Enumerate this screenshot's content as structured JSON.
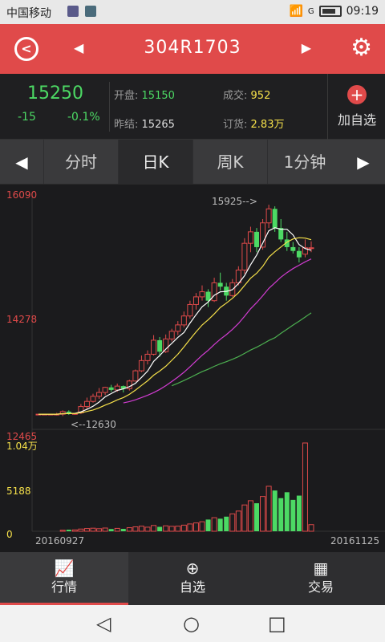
{
  "status": {
    "carrier": "中国移动",
    "signal_label": "G",
    "time": "09:19"
  },
  "header": {
    "title": "304R1703",
    "back_icon": "back-circle-icon",
    "settings_icon": "gear-icon"
  },
  "quote": {
    "price": "15250",
    "change": "-15",
    "change_pct": "-0.1%",
    "open_label": "开盘:",
    "open_value": "15150",
    "prev_label": "昨结:",
    "prev_value": "15265",
    "vol_label": "成交:",
    "vol_value": "952",
    "oi_label": "订货:",
    "oi_value": "2.83万",
    "add_label": "加自选"
  },
  "tabs": {
    "items": [
      "分时",
      "日K",
      "周K",
      "1分钟"
    ],
    "active": 1
  },
  "chart_data": {
    "type": "candlestick",
    "price_axis": {
      "max": "16090",
      "mid": "14278",
      "min": "12465"
    },
    "volume_axis": {
      "max": "1.04万",
      "mid": "5188",
      "min": "0"
    },
    "x_axis": {
      "start": "20160927",
      "end": "20161125"
    },
    "annotations": {
      "high": "15925-->",
      "low": "<--12630"
    },
    "ylim": [
      12465,
      16090
    ],
    "candles": [
      [
        12640,
        12640,
        12640,
        12640
      ],
      [
        12640,
        12640,
        12640,
        12640
      ],
      [
        12640,
        12640,
        12640,
        12640
      ],
      [
        12640,
        12660,
        12620,
        12640
      ],
      [
        12640,
        12700,
        12610,
        12680
      ],
      [
        12680,
        12700,
        12630,
        12650
      ],
      [
        12650,
        12660,
        12630,
        12650
      ],
      [
        12660,
        12800,
        12640,
        12760
      ],
      [
        12760,
        12900,
        12720,
        12840
      ],
      [
        12840,
        12960,
        12820,
        12920
      ],
      [
        12920,
        13050,
        12880,
        12980
      ],
      [
        12980,
        13070,
        12940,
        13060
      ],
      [
        13060,
        13100,
        12990,
        13020
      ],
      [
        13020,
        13120,
        12990,
        13080
      ],
      [
        13080,
        13090,
        12980,
        13040
      ],
      [
        13040,
        13180,
        13010,
        13160
      ],
      [
        13160,
        13340,
        13150,
        13320
      ],
      [
        13320,
        13560,
        13300,
        13480
      ],
      [
        13480,
        13640,
        13420,
        13580
      ],
      [
        13580,
        13880,
        13560,
        13800
      ],
      [
        13800,
        13850,
        13540,
        13620
      ],
      [
        13620,
        13890,
        13600,
        13820
      ],
      [
        13820,
        13980,
        13780,
        13940
      ],
      [
        13940,
        14100,
        13880,
        14040
      ],
      [
        14040,
        14250,
        14000,
        14180
      ],
      [
        14180,
        14420,
        14140,
        14360
      ],
      [
        14360,
        14540,
        14280,
        14480
      ],
      [
        14480,
        14660,
        14420,
        14560
      ],
      [
        14560,
        14600,
        14320,
        14420
      ],
      [
        14420,
        14780,
        14400,
        14700
      ],
      [
        14700,
        14860,
        14580,
        14640
      ],
      [
        14640,
        14700,
        14420,
        14500
      ],
      [
        14500,
        14760,
        14480,
        14700
      ],
      [
        14700,
        14960,
        14660,
        14900
      ],
      [
        14900,
        15400,
        14840,
        15320
      ],
      [
        15320,
        15580,
        15180,
        15500
      ],
      [
        15500,
        15560,
        15180,
        15260
      ],
      [
        15260,
        15700,
        15220,
        15640
      ],
      [
        15640,
        15925,
        15560,
        15860
      ],
      [
        15860,
        15900,
        15500,
        15560
      ],
      [
        15560,
        15700,
        15340,
        15380
      ],
      [
        15380,
        15500,
        15200,
        15260
      ],
      [
        15260,
        15340,
        15160,
        15200
      ],
      [
        15200,
        15260,
        15020,
        15100
      ],
      [
        15150,
        15380,
        15100,
        15250
      ],
      [
        15250,
        15350,
        15180,
        15250
      ]
    ],
    "volumes": [
      0,
      0,
      0,
      0,
      120,
      180,
      160,
      260,
      320,
      360,
      300,
      380,
      260,
      340,
      280,
      420,
      520,
      600,
      480,
      680,
      520,
      640,
      580,
      600,
      720,
      860,
      980,
      1120,
      1380,
      1600,
      1480,
      1720,
      2050,
      2380,
      3100,
      3600,
      3300,
      4100,
      5300,
      4800,
      3900,
      4600,
      3700,
      4200,
      10400,
      780
    ],
    "volumes_unit": "contracts"
  },
  "bottom_nav": {
    "items": [
      {
        "label": "行情",
        "icon": "chart-line-icon"
      },
      {
        "label": "自选",
        "icon": "add-circle-icon"
      },
      {
        "label": "交易",
        "icon": "calendar-icon"
      }
    ]
  },
  "colors": {
    "brand": "#e04a4a",
    "up": "#e04a4a",
    "down": "#4cd964",
    "ma5": "#ffffff",
    "ma10": "#f5e04a",
    "ma20": "#d23cd2",
    "ma60": "#4caf50"
  }
}
